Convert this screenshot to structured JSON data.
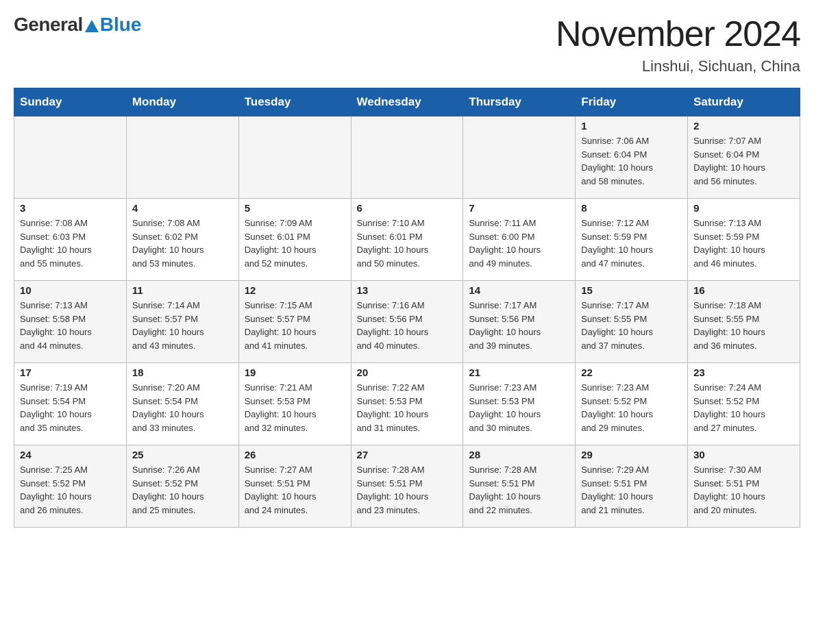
{
  "header": {
    "logo_general": "General",
    "logo_blue": "Blue",
    "month_title": "November 2024",
    "location": "Linshui, Sichuan, China"
  },
  "days_of_week": [
    "Sunday",
    "Monday",
    "Tuesday",
    "Wednesday",
    "Thursday",
    "Friday",
    "Saturday"
  ],
  "weeks": [
    [
      {
        "day": "",
        "info": ""
      },
      {
        "day": "",
        "info": ""
      },
      {
        "day": "",
        "info": ""
      },
      {
        "day": "",
        "info": ""
      },
      {
        "day": "",
        "info": ""
      },
      {
        "day": "1",
        "info": "Sunrise: 7:06 AM\nSunset: 6:04 PM\nDaylight: 10 hours\nand 58 minutes."
      },
      {
        "day": "2",
        "info": "Sunrise: 7:07 AM\nSunset: 6:04 PM\nDaylight: 10 hours\nand 56 minutes."
      }
    ],
    [
      {
        "day": "3",
        "info": "Sunrise: 7:08 AM\nSunset: 6:03 PM\nDaylight: 10 hours\nand 55 minutes."
      },
      {
        "day": "4",
        "info": "Sunrise: 7:08 AM\nSunset: 6:02 PM\nDaylight: 10 hours\nand 53 minutes."
      },
      {
        "day": "5",
        "info": "Sunrise: 7:09 AM\nSunset: 6:01 PM\nDaylight: 10 hours\nand 52 minutes."
      },
      {
        "day": "6",
        "info": "Sunrise: 7:10 AM\nSunset: 6:01 PM\nDaylight: 10 hours\nand 50 minutes."
      },
      {
        "day": "7",
        "info": "Sunrise: 7:11 AM\nSunset: 6:00 PM\nDaylight: 10 hours\nand 49 minutes."
      },
      {
        "day": "8",
        "info": "Sunrise: 7:12 AM\nSunset: 5:59 PM\nDaylight: 10 hours\nand 47 minutes."
      },
      {
        "day": "9",
        "info": "Sunrise: 7:13 AM\nSunset: 5:59 PM\nDaylight: 10 hours\nand 46 minutes."
      }
    ],
    [
      {
        "day": "10",
        "info": "Sunrise: 7:13 AM\nSunset: 5:58 PM\nDaylight: 10 hours\nand 44 minutes."
      },
      {
        "day": "11",
        "info": "Sunrise: 7:14 AM\nSunset: 5:57 PM\nDaylight: 10 hours\nand 43 minutes."
      },
      {
        "day": "12",
        "info": "Sunrise: 7:15 AM\nSunset: 5:57 PM\nDaylight: 10 hours\nand 41 minutes."
      },
      {
        "day": "13",
        "info": "Sunrise: 7:16 AM\nSunset: 5:56 PM\nDaylight: 10 hours\nand 40 minutes."
      },
      {
        "day": "14",
        "info": "Sunrise: 7:17 AM\nSunset: 5:56 PM\nDaylight: 10 hours\nand 39 minutes."
      },
      {
        "day": "15",
        "info": "Sunrise: 7:17 AM\nSunset: 5:55 PM\nDaylight: 10 hours\nand 37 minutes."
      },
      {
        "day": "16",
        "info": "Sunrise: 7:18 AM\nSunset: 5:55 PM\nDaylight: 10 hours\nand 36 minutes."
      }
    ],
    [
      {
        "day": "17",
        "info": "Sunrise: 7:19 AM\nSunset: 5:54 PM\nDaylight: 10 hours\nand 35 minutes."
      },
      {
        "day": "18",
        "info": "Sunrise: 7:20 AM\nSunset: 5:54 PM\nDaylight: 10 hours\nand 33 minutes."
      },
      {
        "day": "19",
        "info": "Sunrise: 7:21 AM\nSunset: 5:53 PM\nDaylight: 10 hours\nand 32 minutes."
      },
      {
        "day": "20",
        "info": "Sunrise: 7:22 AM\nSunset: 5:53 PM\nDaylight: 10 hours\nand 31 minutes."
      },
      {
        "day": "21",
        "info": "Sunrise: 7:23 AM\nSunset: 5:53 PM\nDaylight: 10 hours\nand 30 minutes."
      },
      {
        "day": "22",
        "info": "Sunrise: 7:23 AM\nSunset: 5:52 PM\nDaylight: 10 hours\nand 29 minutes."
      },
      {
        "day": "23",
        "info": "Sunrise: 7:24 AM\nSunset: 5:52 PM\nDaylight: 10 hours\nand 27 minutes."
      }
    ],
    [
      {
        "day": "24",
        "info": "Sunrise: 7:25 AM\nSunset: 5:52 PM\nDaylight: 10 hours\nand 26 minutes."
      },
      {
        "day": "25",
        "info": "Sunrise: 7:26 AM\nSunset: 5:52 PM\nDaylight: 10 hours\nand 25 minutes."
      },
      {
        "day": "26",
        "info": "Sunrise: 7:27 AM\nSunset: 5:51 PM\nDaylight: 10 hours\nand 24 minutes."
      },
      {
        "day": "27",
        "info": "Sunrise: 7:28 AM\nSunset: 5:51 PM\nDaylight: 10 hours\nand 23 minutes."
      },
      {
        "day": "28",
        "info": "Sunrise: 7:28 AM\nSunset: 5:51 PM\nDaylight: 10 hours\nand 22 minutes."
      },
      {
        "day": "29",
        "info": "Sunrise: 7:29 AM\nSunset: 5:51 PM\nDaylight: 10 hours\nand 21 minutes."
      },
      {
        "day": "30",
        "info": "Sunrise: 7:30 AM\nSunset: 5:51 PM\nDaylight: 10 hours\nand 20 minutes."
      }
    ]
  ]
}
